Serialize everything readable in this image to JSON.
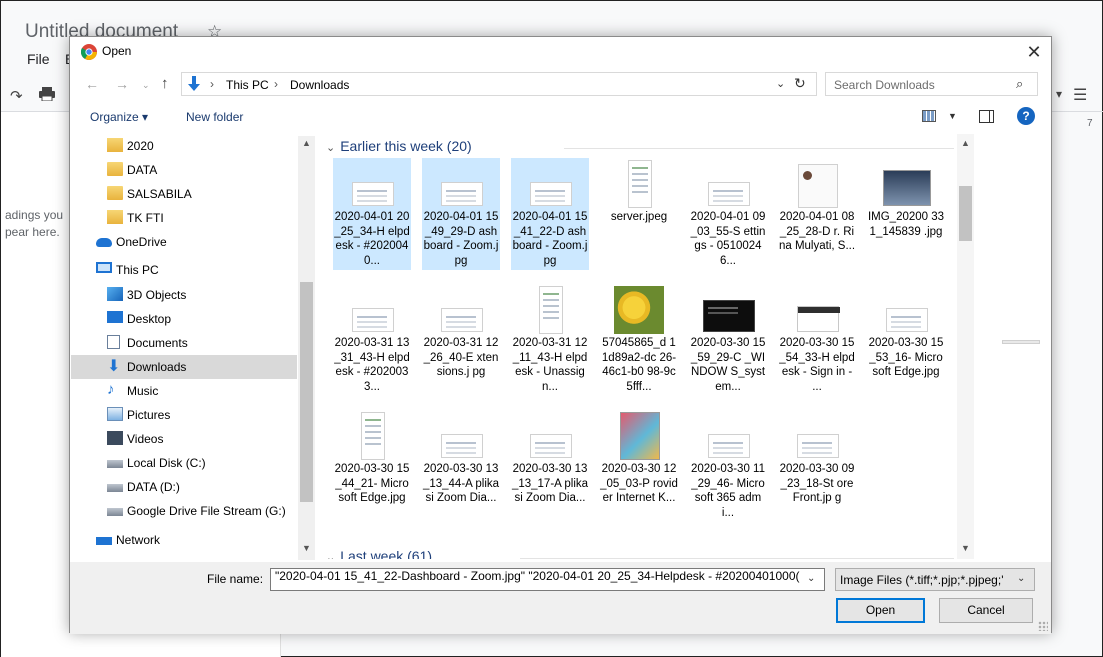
{
  "docs": {
    "title": "Untitled document",
    "menu_file": "File",
    "menu_edit_partial": "E",
    "outline_text_1": "adings you",
    "outline_text_2": "pear here.",
    "ruler_number": "7"
  },
  "dialog": {
    "title": "Open",
    "close_glyph": "✕"
  },
  "address": {
    "back_glyph": "←",
    "forward_glyph": "→",
    "recent_glyph": "⌄",
    "up_glyph": "↑",
    "crumbs": [
      "This PC",
      "Downloads"
    ],
    "separator": "›",
    "dropdown_glyph": "⌄",
    "refresh_glyph": "↻"
  },
  "search": {
    "placeholder": "Search Downloads",
    "icon_glyph": "⌕"
  },
  "toolbar": {
    "organize_label": "Organize ▾",
    "new_folder_label": "New folder",
    "help_label": "?"
  },
  "nav": {
    "items": [
      {
        "label": "2020",
        "icon": "sync-folder-icon"
      },
      {
        "label": "DATA",
        "icon": "folder-icon"
      },
      {
        "label": "SALSABILA",
        "icon": "folder-icon"
      },
      {
        "label": "TK FTI",
        "icon": "sync-folder-icon"
      },
      {
        "label": "OneDrive",
        "icon": "onedrive-icon"
      },
      {
        "label": "This PC",
        "icon": "this-pc-icon"
      },
      {
        "label": "3D Objects",
        "icon": "3d-objects-icon"
      },
      {
        "label": "Desktop",
        "icon": "desktop-icon"
      },
      {
        "label": "Documents",
        "icon": "documents-icon"
      },
      {
        "label": "Downloads",
        "icon": "downloads-icon"
      },
      {
        "label": "Music",
        "icon": "music-icon"
      },
      {
        "label": "Pictures",
        "icon": "pictures-icon"
      },
      {
        "label": "Videos",
        "icon": "videos-icon"
      },
      {
        "label": "Local Disk (C:)",
        "icon": "local-disk-icon"
      },
      {
        "label": "DATA (D:)",
        "icon": "drive-icon"
      },
      {
        "label": "Google Drive File Stream (G:)",
        "icon": "drive-icon"
      },
      {
        "label": "Network",
        "icon": "network-icon"
      }
    ],
    "selected_label": "Downloads"
  },
  "groups": {
    "earlier_this_week": "Earlier this week (20)",
    "last_week": "Last week (61)",
    "chevron": "⌄"
  },
  "files": [
    {
      "name": "2020-04-01 20_25_34-H elpdesk - #2020040...",
      "thumb": "doc",
      "selected": true
    },
    {
      "name": "2020-04-01 15_49_29-D ashboard - Zoom.jpg",
      "thumb": "doc",
      "selected": true
    },
    {
      "name": "2020-04-01 15_41_22-D ashboard - Zoom.jpg",
      "thumb": "doc",
      "selected": true
    },
    {
      "name": "server.jpeg",
      "thumb": "tall",
      "selected": false
    },
    {
      "name": "2020-04-01 09_03_55-S ettings - 05100246...",
      "thumb": "doc",
      "selected": false
    },
    {
      "name": "2020-04-01 08_25_28-D r. Rina Mulyati, S...",
      "thumb": "person",
      "selected": false
    },
    {
      "name": "IMG_20200 331_145839 .jpg",
      "thumb": "photo-dark",
      "selected": false
    },
    {
      "name": "2020-03-31 13_31_43-H elpdesk - #2020033...",
      "thumb": "doc",
      "selected": false
    },
    {
      "name": "2020-03-31 12_26_40-E xtensions.j pg",
      "thumb": "doc",
      "selected": false
    },
    {
      "name": "2020-03-31 12_11_43-H elpdesk - Unassign...",
      "thumb": "tall",
      "selected": false
    },
    {
      "name": "57045865_d 11d89a2-dc 26-46c1-b0 98-9c5fff...",
      "thumb": "fruit",
      "selected": false
    },
    {
      "name": "2020-03-30 15_59_29-C _WINDOW S_system...",
      "thumb": "terminal",
      "selected": false
    },
    {
      "name": "2020-03-30 15_54_33-H elpdesk - Sign in - ...",
      "thumb": "helpdesk",
      "selected": false
    },
    {
      "name": "2020-03-30 15_53_16- Microsoft Edge.jpg",
      "thumb": "doc",
      "selected": false
    },
    {
      "name": "2020-03-30 15_44_21- Microsoft Edge.jpg",
      "thumb": "tall",
      "selected": false
    },
    {
      "name": "2020-03-30 13_13_44-A plikasi Zoom Dia...",
      "thumb": "doc",
      "selected": false
    },
    {
      "name": "2020-03-30 13_13_17-A plikasi Zoom Dia...",
      "thumb": "doc",
      "selected": false
    },
    {
      "name": "2020-03-30 12_05_03-P rovider Internet K...",
      "thumb": "phone",
      "selected": false
    },
    {
      "name": "2020-03-30 11_29_46- Microsoft 365 admi...",
      "thumb": "doc",
      "selected": false
    },
    {
      "name": "2020-03-30 09_23_18-St oreFront.jp g",
      "thumb": "doc",
      "selected": false
    }
  ],
  "bottom": {
    "filename_label": "File name:",
    "filename_value": "\"2020-04-01 15_41_22-Dashboard - Zoom.jpg\" \"2020-04-01 20_25_34-Helpdesk - #20200401000(",
    "filetype_value": "Image Files (*.tiff;*.pjp;*.pjpeg;'",
    "open_label": "Open",
    "cancel_label": "Cancel",
    "dropdown_glyph": "⌄"
  },
  "colors": {
    "selection": "#cce8ff",
    "nav_selected": "#d9d9d9",
    "accent": "#0078d7",
    "group_header": "#1e3f7a"
  }
}
